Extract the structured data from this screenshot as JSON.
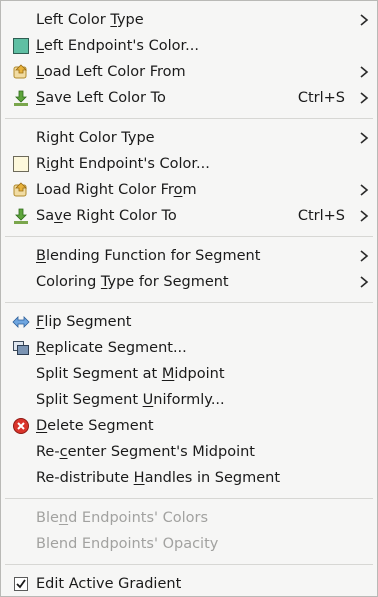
{
  "menu": {
    "items": [
      {
        "id": "left-color-type",
        "label": "Left Color Type",
        "mnemonic": "",
        "submenu": true
      },
      {
        "id": "left-endpoint-color",
        "label": "Left Endpoint's Color...",
        "icon": "swatch-teal-icon",
        "swatch": "#5fbfa3"
      },
      {
        "id": "load-left-color",
        "label": "Load Left Color From",
        "icon": "load-color-icon",
        "submenu": true
      },
      {
        "id": "save-left-color",
        "label": "Save Left Color To",
        "icon": "save-color-icon",
        "shortcut": "Ctrl+S",
        "submenu": true
      },
      {
        "id": "right-color-type",
        "label": "Right Color Type",
        "submenu": true
      },
      {
        "id": "right-endpoint-color",
        "label": "Right Endpoint's Color...",
        "icon": "swatch-cream-icon",
        "swatch": "#fdf8dc"
      },
      {
        "id": "load-right-color",
        "label": "Load Right Color From",
        "icon": "load-color-icon",
        "submenu": true
      },
      {
        "id": "save-right-color",
        "label": "Save Right Color To",
        "icon": "save-color-icon",
        "shortcut": "Ctrl+S",
        "submenu": true
      },
      {
        "id": "blending-function",
        "label": "Blending Function for Segment",
        "submenu": true
      },
      {
        "id": "coloring-type",
        "label": "Coloring Type for Segment",
        "submenu": true
      },
      {
        "id": "flip-segment",
        "label": "Flip Segment",
        "icon": "flip-icon"
      },
      {
        "id": "replicate-segment",
        "label": "Replicate Segment...",
        "icon": "replicate-icon"
      },
      {
        "id": "split-midpoint",
        "label": "Split Segment at Midpoint"
      },
      {
        "id": "split-uniformly",
        "label": "Split Segment Uniformly..."
      },
      {
        "id": "delete-segment",
        "label": "Delete Segment",
        "icon": "delete-icon"
      },
      {
        "id": "recenter-midpoint",
        "label": "Re-center Segment's Midpoint"
      },
      {
        "id": "redistribute-handles",
        "label": "Re-distribute Handles in Segment"
      },
      {
        "id": "blend-colors",
        "label": "Blend Endpoints' Colors",
        "disabled": true
      },
      {
        "id": "blend-opacity",
        "label": "Blend Endpoints' Opacity",
        "disabled": true
      },
      {
        "id": "edit-active-gradient",
        "label": "Edit Active Gradient",
        "icon": "checkbox-checked-icon",
        "checked": true
      }
    ]
  },
  "colors": {
    "accent_swatch_left": "#5fbfa3",
    "accent_swatch_right": "#fdf8dc",
    "delete_red": "#d9342b",
    "disabled_text": "#a2a2a0"
  }
}
